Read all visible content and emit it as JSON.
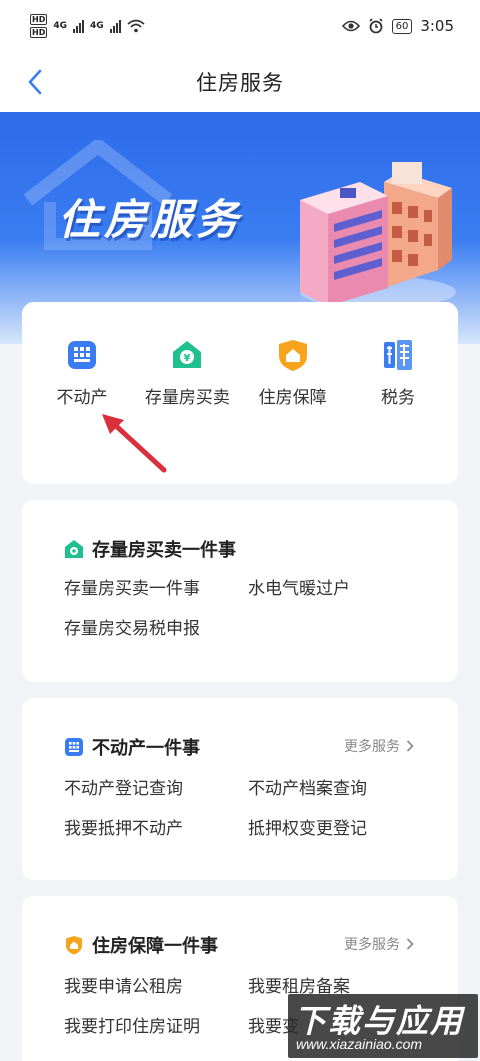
{
  "status_bar": {
    "hd_badges": [
      "HD",
      "HD"
    ],
    "network": [
      "4G",
      "4G"
    ],
    "battery": "60",
    "time": "3:05"
  },
  "nav": {
    "title": "住房服务"
  },
  "banner": {
    "title": "住房服务"
  },
  "grid": {
    "items": [
      {
        "label": "不动产",
        "icon": "building-icon"
      },
      {
        "label": "存量房买卖",
        "icon": "house-yuan-icon"
      },
      {
        "label": "住房保障",
        "icon": "shield-house-icon"
      },
      {
        "label": "税务",
        "icon": "tax-icon"
      }
    ]
  },
  "sections": [
    {
      "title": "存量房买卖一件事",
      "icon": "house-yuan-icon",
      "more": "",
      "links": [
        "存量房买卖一件事",
        "水电气暖过户",
        "存量房交易税申报"
      ]
    },
    {
      "title": "不动产一件事",
      "icon": "building-icon",
      "more": "更多服务",
      "links": [
        "不动产登记查询",
        "不动产档案查询",
        "我要抵押不动产",
        "抵押权变更登记"
      ]
    },
    {
      "title": "住房保障一件事",
      "icon": "shield-house-icon",
      "more": "更多服务",
      "links": [
        "我要申请公租房",
        "我要租房备案",
        "我要打印住房证明",
        "我要变"
      ]
    }
  ],
  "watermark": {
    "logo": "下载与应用",
    "url": "www.xiazainiao.com"
  },
  "colors": {
    "primary_blue": "#3a7df2",
    "green": "#1fbf8f",
    "orange": "#f8a31c",
    "arrow_red": "#d9303b"
  }
}
